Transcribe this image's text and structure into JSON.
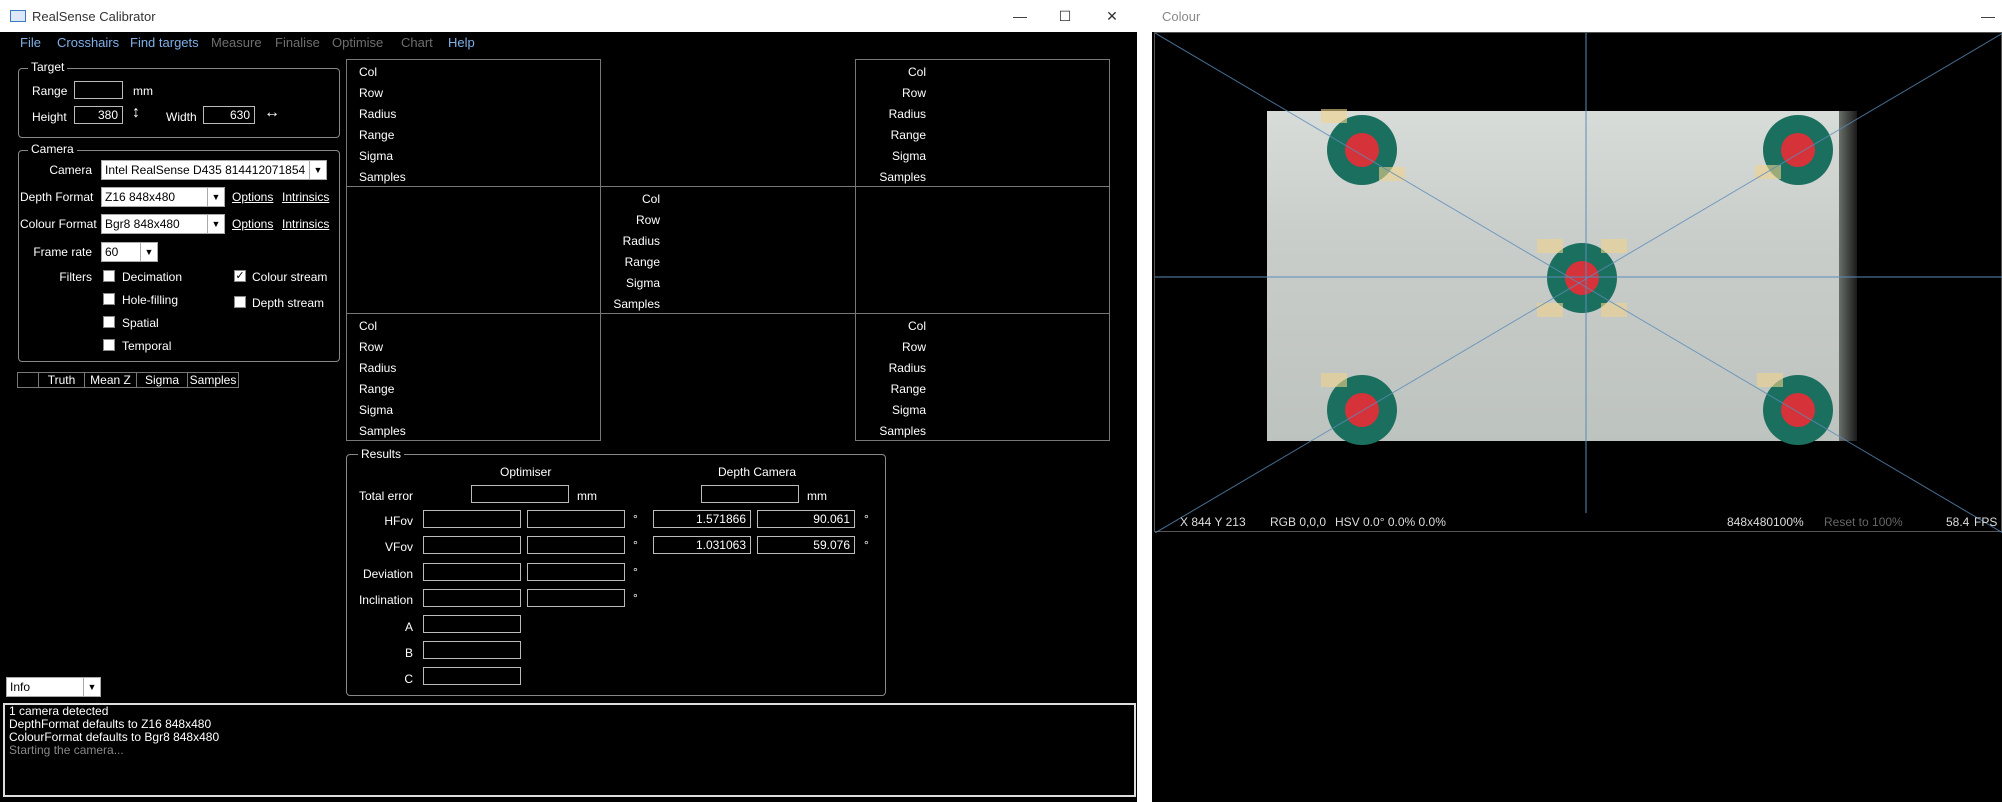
{
  "main_window": {
    "title": "RealSense Calibrator",
    "menu": [
      "File",
      "Crosshairs",
      "Find targets",
      "Measure",
      "Finalise",
      "Optimise",
      "Chart",
      "Help"
    ],
    "target": {
      "group_label": "Target",
      "range_label": "Range",
      "range_value": "",
      "range_unit": "mm",
      "height_label": "Height",
      "height_value": "380",
      "width_label": "Width",
      "width_value": "630"
    },
    "camera": {
      "group_label": "Camera",
      "camera_label": "Camera",
      "camera_value": "Intel RealSense D435 814412071854",
      "depth_format_label": "Depth Format",
      "depth_format_value": "Z16 848x480",
      "colour_format_label": "Colour Format",
      "colour_format_value": "Bgr8 848x480",
      "options_label": "Options",
      "intrinsics_label": "Intrinsics",
      "frame_rate_label": "Frame rate",
      "frame_rate_value": "60",
      "filters_label": "Filters",
      "filters": [
        {
          "label": "Decimation",
          "checked": false
        },
        {
          "label": "Hole-filling",
          "checked": false
        },
        {
          "label": "Spatial",
          "checked": false
        },
        {
          "label": "Temporal",
          "checked": false
        }
      ],
      "streams": [
        {
          "label": "Colour stream",
          "checked": true
        },
        {
          "label": "Depth stream",
          "checked": false
        }
      ]
    },
    "truth_table": {
      "headers": [
        "",
        "Truth",
        "Mean Z",
        "Sigma",
        "Samples"
      ]
    },
    "cell_labels": [
      "Col",
      "Row",
      "Radius",
      "Range",
      "Sigma",
      "Samples"
    ],
    "results": {
      "group_label": "Results",
      "optimiser_label": "Optimiser",
      "depth_camera_label": "Depth Camera",
      "total_error_label": "Total error",
      "mm": "mm",
      "degree": "°",
      "rows": [
        {
          "label": "HFov",
          "opt1": "",
          "opt2": "",
          "cam1": "1.571866",
          "cam2": "90.061"
        },
        {
          "label": "VFov",
          "opt1": "",
          "opt2": "",
          "cam1": "1.031063",
          "cam2": "59.076"
        },
        {
          "label": "Deviation",
          "opt1": "",
          "opt2": ""
        },
        {
          "label": "Inclination",
          "opt1": "",
          "opt2": ""
        }
      ],
      "abc": [
        "A",
        "B",
        "C"
      ]
    },
    "log_level": "Info",
    "log": [
      {
        "text": "1 camera detected",
        "dim": false
      },
      {
        "text": "DepthFormat defaults to Z16 848x480",
        "dim": false
      },
      {
        "text": "ColourFormat defaults to Bgr8 848x480",
        "dim": false
      },
      {
        "text": "Starting the camera...",
        "dim": true
      }
    ]
  },
  "colour_window": {
    "title": "Colour",
    "status": {
      "coords": "X 844 Y 213",
      "rgb": "RGB 0,0,0",
      "hsv": "HSV 0.0° 0.0% 0.0%",
      "resolution": "848x480",
      "zoom": "100%",
      "reset": "Reset to 100%",
      "fps_value": "58.4",
      "fps_label": "FPS"
    }
  },
  "colors": {
    "menu_active": "#7fb0e8",
    "menu_disabled": "#6f6f6f",
    "target_ring": "#1b6f5e",
    "target_center": "#d6323a",
    "crosshair": "#5b8bb8"
  }
}
